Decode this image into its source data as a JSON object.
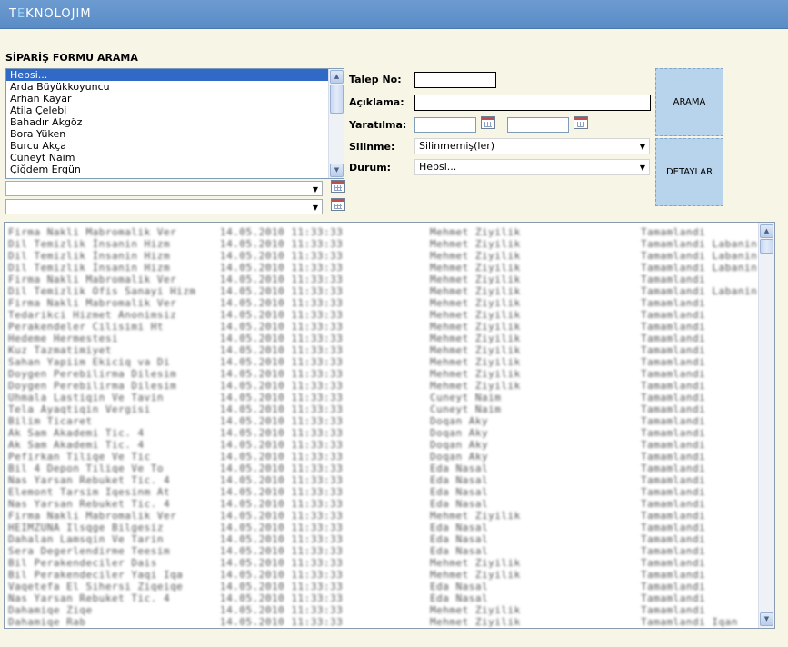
{
  "app": {
    "brand_prefix": "T",
    "brand_e": "E",
    "brand_rest": "KNOLOJIM"
  },
  "form": {
    "title": "SİPARİŞ FORMU ARAMA"
  },
  "customer_list": {
    "options": [
      "Hepsi...",
      "Arda Büyükkoyuncu",
      "Arhan Kayar",
      "Atila Çelebi",
      "Bahadır Akgöz",
      "Bora Yüken",
      "Burcu Akça",
      "Cüneyt Naim",
      "Çiğdem Ergün"
    ],
    "selected_index": 0
  },
  "fields": {
    "talep_no": {
      "label": "Talep No:",
      "value": ""
    },
    "aciklama": {
      "label": "Açıklama:",
      "value": ""
    },
    "yaratilma": {
      "label": "Yaratılma:",
      "from": "",
      "to": ""
    },
    "silinme": {
      "label": "Silinme:",
      "value": "Silinmemiş(ler)"
    },
    "durum": {
      "label": "Durum:",
      "value": "Hepsi..."
    }
  },
  "buttons": {
    "search": "ARAMA",
    "details": "DETAYLAR"
  },
  "results": {
    "rows": [
      [
        "Firma Nakli Mabromalik Ver",
        "14.05.2010 11:33:33",
        "Mehmet Ziyilik",
        "Tamamlandi"
      ],
      [
        "Dil Temizlik İnsanin Hizm",
        "14.05.2010 11:33:33",
        "Mehmet Ziyilik",
        "Tamamlandi Labanin"
      ],
      [
        "Dil Temizlik İnsanin Hizm",
        "14.05.2010 11:33:33",
        "Mehmet Ziyilik",
        "Tamamlandi Labanin"
      ],
      [
        "Dil Temizlik İnsanin Hizm",
        "14.05.2010 11:33:33",
        "Mehmet Ziyilik",
        "Tamamlandi Labanin"
      ],
      [
        "Firma Nakli Mabromalik Ver",
        "14.05.2010 11:33:33",
        "Mehmet Ziyilik",
        "Tamamlandi"
      ],
      [
        "Dil Temizlik Ofis Sanayi Hizm",
        "14.05.2010 11:33:33",
        "Mehmet Ziyilik",
        "Tamamlandi Labanin"
      ],
      [
        "Firma Nakli Mabromalik Ver",
        "14.05.2010 11:33:33",
        "Mehmet Ziyilik",
        "Tamamlandi"
      ],
      [
        "Tedarikci Hizmet Anonimsiz",
        "14.05.2010 11:33:33",
        "Mehmet Ziyilik",
        "Tamamlandi"
      ],
      [
        "Perakendeler Cilisimi Ht",
        "14.05.2010 11:33:33",
        "Mehmet Ziyilik",
        "Tamamlandi"
      ],
      [
        "Hedeme Hermestesi",
        "14.05.2010 11:33:33",
        "Mehmet Ziyilik",
        "Tamamlandi"
      ],
      [
        "Kuz Tazmatimiyet",
        "14.05.2010 11:33:33",
        "Mehmet Ziyilik",
        "Tamamlandi"
      ],
      [
        "Sahan Yapiim Ekiciq va Di",
        "14.05.2010 11:33:33",
        "Mehmet Ziyilik",
        "Tamamlandi"
      ],
      [
        "Doygen Perebilirma Dilesim",
        "14.05.2010 11:33:33",
        "Mehmet Ziyilik",
        "Tamamlandi"
      ],
      [
        "Doygen Perebilirma Dilesim",
        "14.05.2010 11:33:33",
        "Mehmet Ziyilik",
        "Tamamlandi"
      ],
      [
        "Uhmala Lastiqin Ve Tavin",
        "14.05.2010 11:33:33",
        "Cuneyt Naim",
        "Tamamlandi"
      ],
      [
        "Tela Ayaqtiqin Vergisi",
        "14.05.2010 11:33:33",
        "Cuneyt Naim",
        "Tamamlandi"
      ],
      [
        "Bilim Ticaret",
        "14.05.2010 11:33:33",
        "Doqan Aky",
        "Tamamlandi"
      ],
      [
        "Ak Sam Akademi Tic. 4",
        "14.05.2010 11:33:33",
        "Doqan Aky",
        "Tamamlandi"
      ],
      [
        "Ak Sam Akademi Tic. 4",
        "14.05.2010 11:33:33",
        "Doqan Aky",
        "Tamamlandi"
      ],
      [
        "Pefirkan Tiliqe Ve Tic",
        "14.05.2010 11:33:33",
        "Doqan Aky",
        "Tamamlandi"
      ],
      [
        "Bil 4 Depon Tiliqe Ve To",
        "14.05.2010 11:33:33",
        "Eda Nasal",
        "Tamamlandi"
      ],
      [
        "Nas Yarsan Rebuket Tic. 4",
        "14.05.2010 11:33:33",
        "Eda Nasal",
        "Tamamlandi"
      ],
      [
        "Elemont Tarsim Iqesinm At",
        "14.05.2010 11:33:33",
        "Eda Nasal",
        "Tamamlandi"
      ],
      [
        "Nas Yarsan Rebuket Tic. 4",
        "14.05.2010 11:33:33",
        "Eda Nasal",
        "Tamamlandi"
      ],
      [
        "Firma Nakli Mabromalik Ver",
        "14.05.2010 11:33:33",
        "Mehmet Ziyilik",
        "Tamamlandi"
      ],
      [
        "HEIMZUNA Ilsqge Bilgesiz",
        "14.05.2010 11:33:33",
        "Eda Nasal",
        "Tamamlandi"
      ],
      [
        "Dahalan Lamsqin Ve Tarin",
        "14.05.2010 11:33:33",
        "Eda Nasal",
        "Tamamlandi"
      ],
      [
        "Sera Degerlendirme Teesim",
        "14.05.2010 11:33:33",
        "Eda Nasal",
        "Tamamlandi"
      ],
      [
        "Bil Perakendeciler Dais",
        "14.05.2010 11:33:33",
        "Mehmet Ziyilik",
        "Tamamlandi"
      ],
      [
        "Bil Perakendeciler Yaqi Iqa",
        "14.05.2010 11:33:33",
        "Mehmet Ziyilik",
        "Tamamlandi"
      ],
      [
        "Vaqetefa El Sihersi Ziqeiqe",
        "14.05.2010 11:33:33",
        "Eda Nasal",
        "Tamamlandi"
      ],
      [
        "Nas Yarsan Rebuket Tic. 4",
        "14.05.2010 11:33:33",
        "Eda Nasal",
        "Tamamlandi"
      ],
      [
        "Dahamiqe Ziqe",
        "14.05.2010 11:33:33",
        "Mehmet Ziyilik",
        "Tamamlandi"
      ],
      [
        "Dahamiqe Rab",
        "14.05.2010 11:33:33",
        "Mehmet Ziyilik",
        "Tamamlandi Iqan"
      ]
    ]
  }
}
